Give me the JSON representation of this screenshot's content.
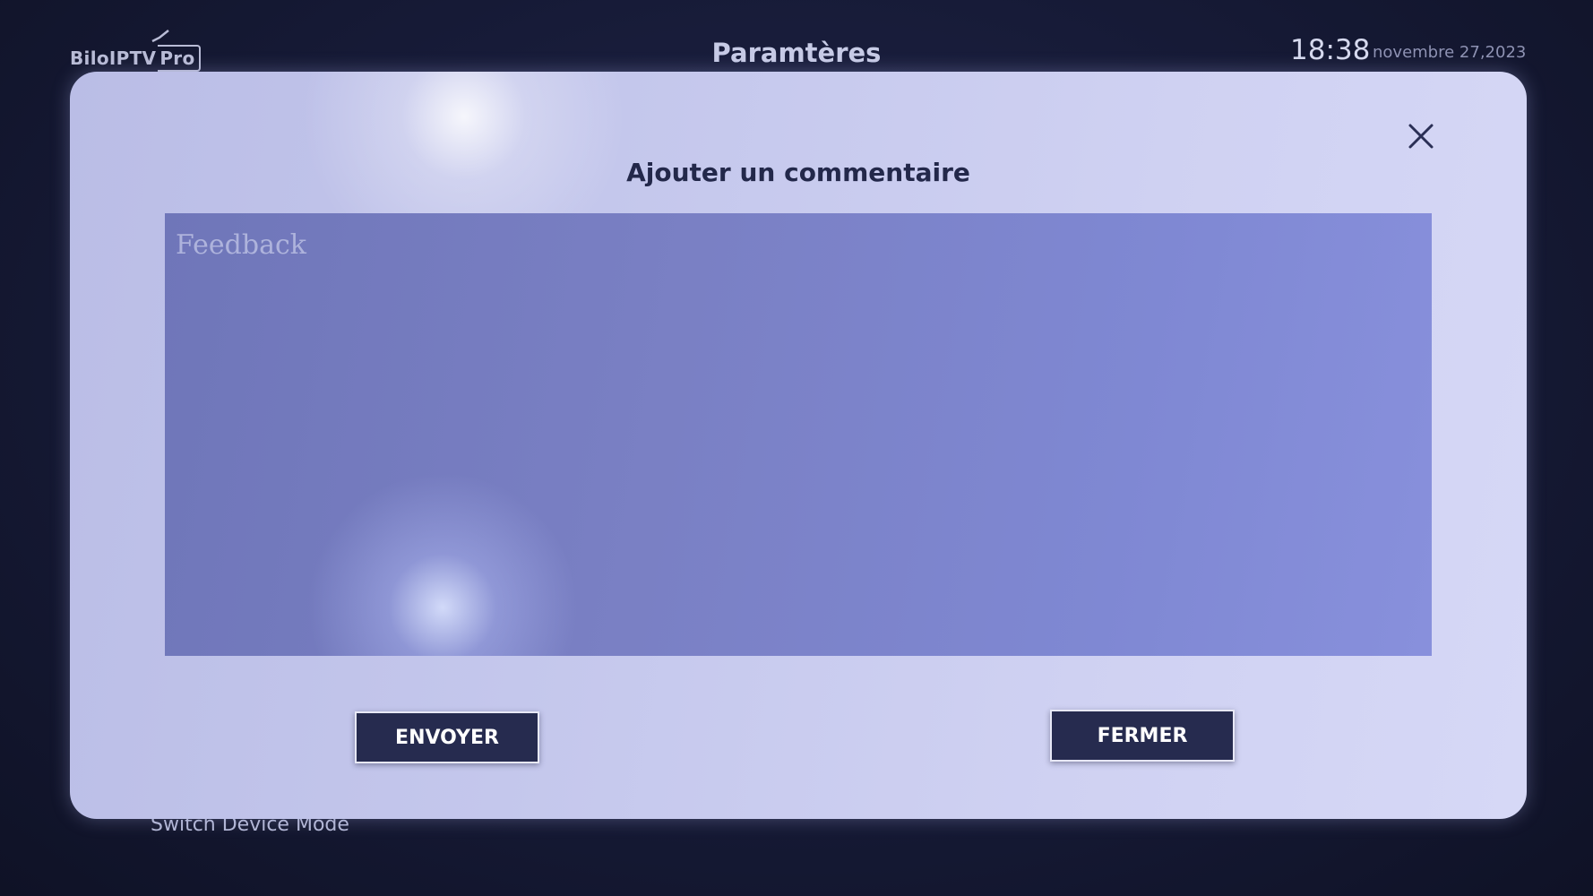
{
  "header": {
    "logo_text": "BiloIPTV",
    "logo_suffix": "Pro",
    "title": "Paramtères",
    "time": "18:38",
    "date": "novembre 27,2023"
  },
  "background": {
    "setting_label": "Switch Device Mode"
  },
  "dialog": {
    "title": "Ajouter un commentaire",
    "feedback_placeholder": "Feedback",
    "feedback_value": "",
    "send_label": "ENVOYER",
    "close_label": "FERMER",
    "close_icon": "close-icon"
  },
  "colors": {
    "button_bg": "#262b4f",
    "dialog_bg": "#c4c7ec",
    "textarea_bg": "#7a80c4",
    "title_text": "#23284a"
  }
}
